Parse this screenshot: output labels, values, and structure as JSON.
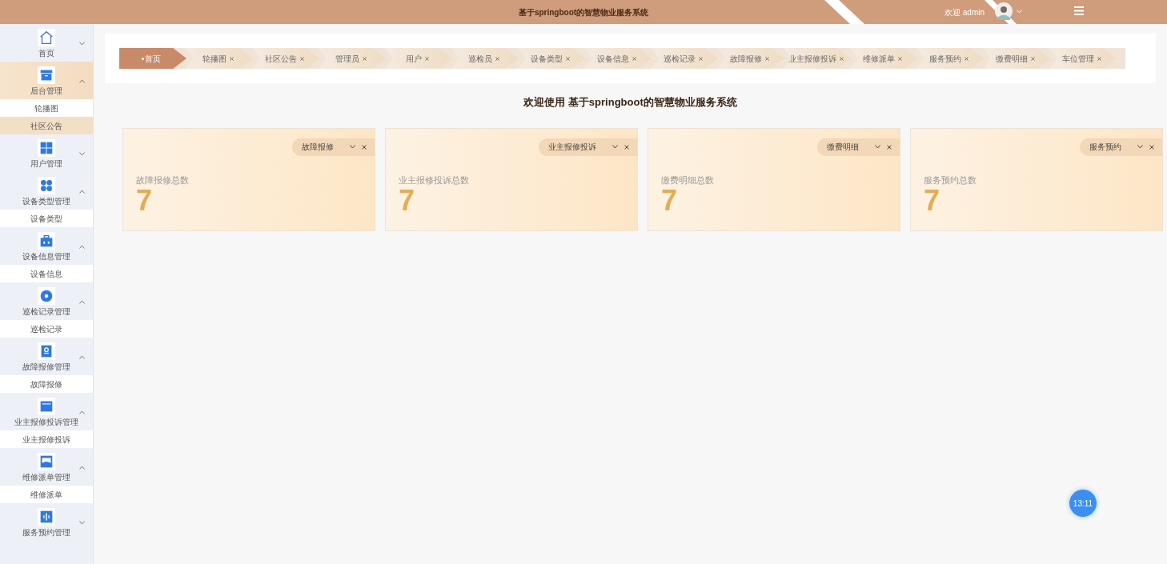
{
  "header": {
    "title": "基于springboot的智慧物业服务系统",
    "greeting": "欢迎 admin"
  },
  "sidebar": {
    "items": [
      {
        "label": "首页",
        "expanded": false
      },
      {
        "label": "后台管理",
        "expanded": true,
        "children": [
          {
            "label": "轮播图",
            "selected": false
          },
          {
            "label": "社区公告",
            "selected": true
          }
        ]
      },
      {
        "label": "用户管理",
        "expanded": false
      },
      {
        "label": "设备类型管理",
        "expanded": true,
        "children": [
          {
            "label": "设备类型",
            "selected": false
          }
        ]
      },
      {
        "label": "设备信息管理",
        "expanded": true,
        "children": [
          {
            "label": "设备信息",
            "selected": false
          }
        ]
      },
      {
        "label": "巡检记录管理",
        "expanded": true,
        "children": [
          {
            "label": "巡检记录",
            "selected": false
          }
        ]
      },
      {
        "label": "故障报修管理",
        "expanded": true,
        "children": [
          {
            "label": "故障报修",
            "selected": false
          }
        ]
      },
      {
        "label": "业主报修投诉管理",
        "expanded": true,
        "children": [
          {
            "label": "业主报修投诉",
            "selected": false
          }
        ]
      },
      {
        "label": "维修派单管理",
        "expanded": true,
        "children": [
          {
            "label": "维修派单",
            "selected": false
          }
        ]
      },
      {
        "label": "服务预约管理",
        "expanded": false
      }
    ]
  },
  "tabs": [
    {
      "label": "首页",
      "selected": true,
      "closable": false
    },
    {
      "label": "轮播图",
      "selected": false,
      "closable": true
    },
    {
      "label": "社区公告",
      "selected": false,
      "closable": true
    },
    {
      "label": "管理员",
      "selected": false,
      "closable": true
    },
    {
      "label": "用户",
      "selected": false,
      "closable": true
    },
    {
      "label": "巡检员",
      "selected": false,
      "closable": true
    },
    {
      "label": "设备类型",
      "selected": false,
      "closable": true
    },
    {
      "label": "设备信息",
      "selected": false,
      "closable": true
    },
    {
      "label": "巡检记录",
      "selected": false,
      "closable": true
    },
    {
      "label": "故障报修",
      "selected": false,
      "closable": true
    },
    {
      "label": "业主报修投诉",
      "selected": false,
      "closable": true
    },
    {
      "label": "维修派单",
      "selected": false,
      "closable": true
    },
    {
      "label": "服务预约",
      "selected": false,
      "closable": true
    },
    {
      "label": "缴费明细",
      "selected": false,
      "closable": true
    },
    {
      "label": "车位管理",
      "selected": false,
      "closable": true
    }
  ],
  "welcome": "欢迎使用 基于springboot的智慧物业服务系统",
  "cards": [
    {
      "selector": "故障报修",
      "label": "故障报修总数",
      "value": "7"
    },
    {
      "selector": "业主报修投诉",
      "label": "业主报修投诉总数",
      "value": "7"
    },
    {
      "selector": "缴费明细",
      "label": "缴费明细总数",
      "value": "7"
    },
    {
      "selector": "服务预约",
      "label": "服务预约总数",
      "value": "7"
    }
  ],
  "clock_badge": "13:11"
}
